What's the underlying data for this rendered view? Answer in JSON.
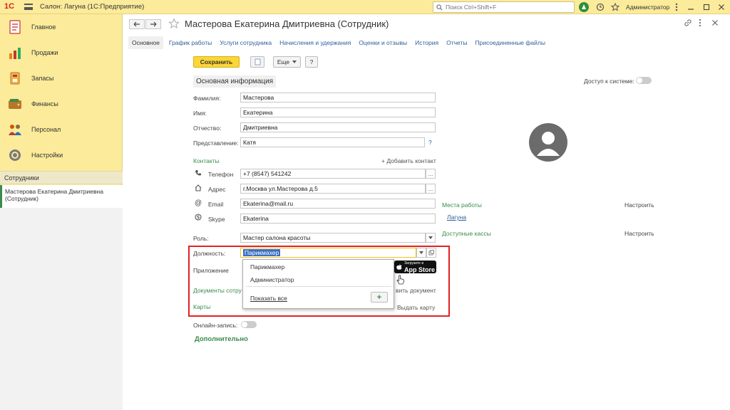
{
  "titlebar": {
    "logo": "1С",
    "title": "Салон: Лагуна  (1С:Предприятие)",
    "search_placeholder": "Поиск Ctrl+Shift+F",
    "user": "Администратор"
  },
  "sidebar": {
    "items": [
      {
        "label": "Главное",
        "icon": "home-list-icon"
      },
      {
        "label": "Продажи",
        "icon": "sales-chart-icon"
      },
      {
        "label": "Запасы",
        "icon": "stock-box-icon"
      },
      {
        "label": "Финансы",
        "icon": "wallet-icon"
      },
      {
        "label": "Персонал",
        "icon": "people-icon"
      },
      {
        "label": "Настройки",
        "icon": "gear-icon"
      }
    ],
    "section_header": "Сотрудники",
    "open_doc": "Мастерова Екатерина Дмитриевна (Сотрудник)"
  },
  "doc": {
    "title": "Мастерова Екатерина Дмитриевна (Сотрудник)",
    "tabs": [
      "Основное",
      "График работы",
      "Услуги сотрудника",
      "Начисления и удержания",
      "Оценки и отзывы",
      "История",
      "Отчеты",
      "Присоединенные файлы"
    ]
  },
  "toolbar": {
    "save": "Сохранить",
    "more": "Еще",
    "help": "?"
  },
  "form": {
    "section_title": "Основная информация",
    "access_label": "Доступ к системе:",
    "lastname_label": "Фамилия:",
    "lastname": "Мастерова",
    "firstname_label": "Имя:",
    "firstname": "Екатерина",
    "middlename_label": "Отчество:",
    "middlename": "Дмитриевна",
    "display_label": "Представление:",
    "display": "Катя",
    "help_mark": "?",
    "contacts_title": "Контакты",
    "add_contact": "+ Добавить контакт",
    "phone_label": "Телефон",
    "phone": "+7 (8547) 541242",
    "address_label": "Адрес",
    "address": "г.Москва ул.Мастерова д.5",
    "email_label": "Email",
    "email": "Ekaterina@mail.ru",
    "skype_label": "Skype",
    "skype": "Ekaterina",
    "role_label": "Роль:",
    "role": "Мастер салона красоты",
    "position_label": "Должность:",
    "position": "Парикмахер",
    "app_label": "Приложение",
    "docs_label": "Документы сотру",
    "add_doc": "вить документ",
    "cards_label": "Карты",
    "issue_card": "Выдать карту",
    "online_label": "Онлайн-запись:",
    "additional": "Дополнительно",
    "places_title": "Места работы",
    "places_setup": "Настроить",
    "place_1": "Лагуна",
    "cash_title": "Доступные кассы",
    "cash_setup": "Настроить",
    "appstore_small": "Загрузите в",
    "appstore_big": "App Store"
  },
  "dropdown": {
    "options": [
      "Парикмахер",
      "Администратор"
    ],
    "show_all": "Показать все",
    "add": "+"
  },
  "colors": {
    "accent_yellow": "#fbeb9a",
    "primary_button": "#fcd734",
    "green": "#3a8c4b",
    "highlight_red": "#e02323"
  }
}
